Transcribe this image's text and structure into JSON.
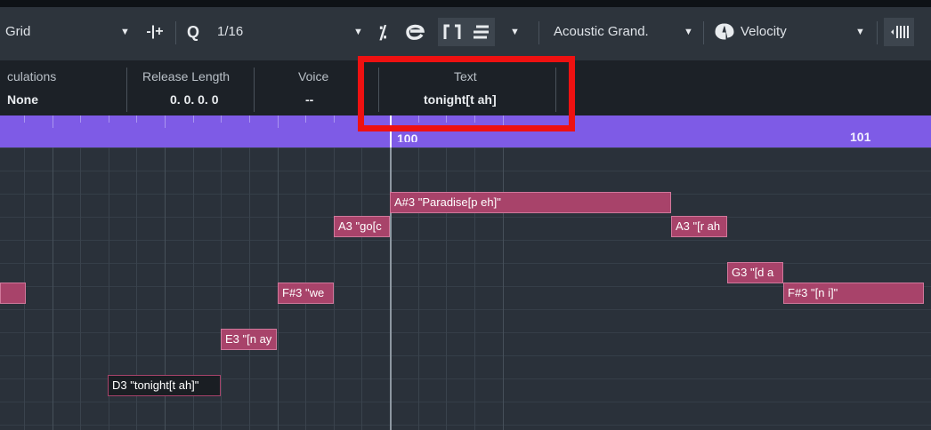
{
  "toolbar": {
    "snap_type": "Grid",
    "quantize_label": "Q",
    "quantize_value": "1/16",
    "instrument": "Acoustic Grand.",
    "controller": "Velocity"
  },
  "info_line": {
    "columns": [
      {
        "header": "culations",
        "value": "None"
      },
      {
        "header": "Release Length",
        "value": "0. 0. 0.  0"
      },
      {
        "header": "Voice",
        "value": "--"
      },
      {
        "header": "Text",
        "value": "tonight[t ah]"
      }
    ]
  },
  "ruler": {
    "bar_100": "100",
    "bar_101": "101"
  },
  "notes": [
    {
      "label": "",
      "pitch": "unknown (left edge)"
    },
    {
      "label": "D3 \"tonight[t ah]\"",
      "selected": true
    },
    {
      "label": "E3 \"[n ay"
    },
    {
      "label": "F#3 \"we"
    },
    {
      "label": "A3 \"go[c"
    },
    {
      "label": "A#3 \"Paradise[p eh]\""
    },
    {
      "label": "A3 \"[r ah"
    },
    {
      "label": "G3 \"[d a"
    },
    {
      "label": "F#3 \"[n i]\""
    }
  ],
  "colors": {
    "note_fill": "#a8436a",
    "ruler": "#7e5be6",
    "highlight": "#ee1111"
  }
}
